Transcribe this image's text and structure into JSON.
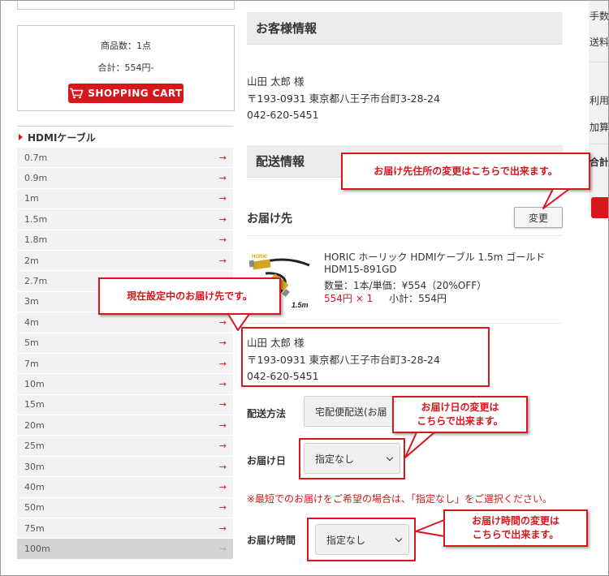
{
  "cart": {
    "item_count": "商品数：1点",
    "total": "合計：554円-",
    "button_label": "SHOPPING CART"
  },
  "category": {
    "title": "HDMIケーブル",
    "arrow": "→",
    "items": [
      "0.7m",
      "0.9m",
      "1m",
      "1.5m",
      "1.8m",
      "2m",
      "2.7m",
      "3m",
      "4m",
      "5m",
      "7m",
      "10m",
      "15m",
      "20m",
      "25m",
      "30m",
      "40m",
      "50m",
      "75m",
      "100m"
    ],
    "active_item": "100m"
  },
  "customer": {
    "heading": "お客様情報",
    "name": "山田 太郎 様",
    "address": "〒193-0931 東京都八王子市台町3-28-24",
    "phone": "042-620-5451"
  },
  "shipping": {
    "heading": "配送情報",
    "destination_label": "お届け先",
    "change_button": "変更",
    "product": {
      "brand_logo": "HORIC",
      "length_label": "1.5m",
      "name_line1": "HORIC ホーリック HDMIケーブル 1.5m ゴールド",
      "name_line2": "HDM15-891GD",
      "qty_price": "数量：1本/単価：¥554（20%OFF）",
      "price_times": "554円 × 1",
      "subtotal": "小計：554円"
    },
    "recipient": {
      "name": "山田 太郎 様",
      "address": "〒193-0931 東京都八王子市台町3-28-24",
      "phone": "042-620-5451"
    },
    "method_label": "配送方法",
    "method_value": "宅配便配送(お届",
    "date_label": "お届け日",
    "date_value": "指定なし",
    "note": "※最短でのお届けをご希望の場合は、「指定なし」をご選択ください。",
    "time_label": "お届け時間",
    "time_value": "指定なし"
  },
  "right_column": {
    "fee": "手数",
    "shipping_fee": "送料",
    "usage": "利用",
    "added": "加算",
    "total": "合計"
  },
  "annotations": {
    "change_address": "お届け先住所の変更はこちらで出来ます。",
    "current_destination": "現在設定中のお届け先です。",
    "date_change_line1": "お届け日の変更は",
    "date_change_line2": "こちらで出来ます。",
    "time_change_line1": "お届け時間の変更は",
    "time_change_line2": "こちらで出来ます。"
  },
  "colors": {
    "accent_red": "#d8161c",
    "section_bg": "#ececec",
    "sidebar_item_bg": "#f2f2f2"
  }
}
